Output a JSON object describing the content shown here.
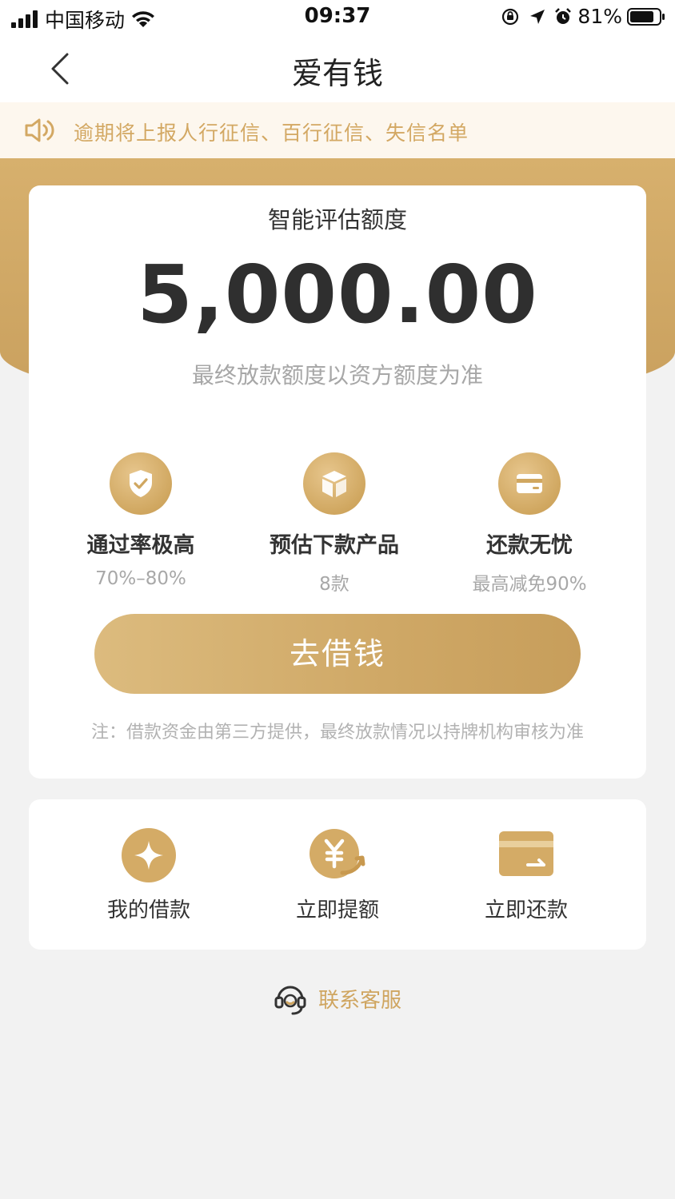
{
  "status_bar": {
    "carrier": "中国移动",
    "time": "09:37",
    "battery": "81%"
  },
  "nav": {
    "title": "爱有钱"
  },
  "notice": {
    "text": "逾期将上报人行征信、百行征信、失信名单"
  },
  "credit_card": {
    "title": "智能评估额度",
    "amount": "5,000.00",
    "subnote": "最终放款额度以资方额度为准",
    "features": [
      {
        "label": "通过率极高",
        "sub": "70%–80%",
        "icon": "shield-check-icon"
      },
      {
        "label": "预估下款产品",
        "sub": "8款",
        "icon": "box-icon"
      },
      {
        "label": "还款无忧",
        "sub": "最高减免90%",
        "icon": "card-icon"
      }
    ],
    "button_label": "去借钱",
    "disclaimer": "注：借款资金由第三方提供，最终放款情况以持牌机构审核为准"
  },
  "quick_actions": [
    {
      "label": "我的借款",
      "icon": "diamond-icon"
    },
    {
      "label": "立即提额",
      "icon": "yen-up-icon"
    },
    {
      "label": "立即还款",
      "icon": "repay-card-icon"
    }
  ],
  "service": {
    "label": "联系客服",
    "icon": "headset-icon"
  },
  "colors": {
    "gold": "#cfa866",
    "gold_light": "#e7c68d",
    "notice_bg": "#fdf7ee",
    "notice_text": "#d3a863",
    "page_bg": "#f2f2f2"
  }
}
